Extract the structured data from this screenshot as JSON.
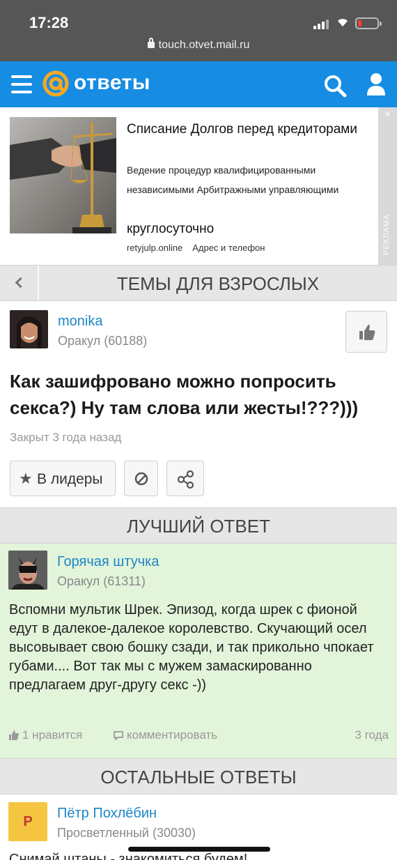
{
  "status_bar": {
    "time": "17:28",
    "url": "touch.otvet.mail.ru"
  },
  "header": {
    "logo_text": "ответы"
  },
  "ad": {
    "title": "Списание Долгов перед кредиторами",
    "description": "Ведение процедур квалифицированными независимыми Арбитражными управляющими",
    "cta": "круглосуточно",
    "domain": "retyjulp.online",
    "contacts_link": "Адрес и телефон",
    "label": "РЕКЛАМА",
    "close": "×"
  },
  "category": {
    "title": "ТЕМЫ ДЛЯ ВЗРОСЛЫХ"
  },
  "question": {
    "author": "monika",
    "rank": "Оракул (60188)",
    "title": "Как зашифровано можно попросить секса?) Ну там слова или жесты!???)))",
    "status": "Закрыт 3 года назад",
    "leaders_label": "В лидеры"
  },
  "best_answer": {
    "section_title": "ЛУЧШИЙ ОТВЕТ",
    "author": "Горячая штучка",
    "rank": "Оракул (61311)",
    "text": "Вспомни мультик Шрек. Эпизод, когда шрек с фионой едут в далекое-далекое королевство. Скучающий осел высовывает свою бошку сзади, и так прикольно чпокает губами.... Вот так мы с мужем замаскированно предлагаем друг-другу секс -))",
    "likes": "1 нравится",
    "comment_label": "комментировать",
    "time": "3 года"
  },
  "other_answers": {
    "section_title": "ОСТАЛЬНЫЕ ОТВЕТЫ",
    "items": [
      {
        "avatar_letter": "Р",
        "author": "Пётр Похлёбин",
        "rank": "Просветленный (30030)",
        "text": "Снимай штаны - знакомиться будем!"
      }
    ]
  },
  "colors": {
    "brand_blue": "#168de2",
    "link_blue": "#1d86c9",
    "best_answer_bg": "#e2f4da",
    "logo_orange": "#f7a823"
  }
}
